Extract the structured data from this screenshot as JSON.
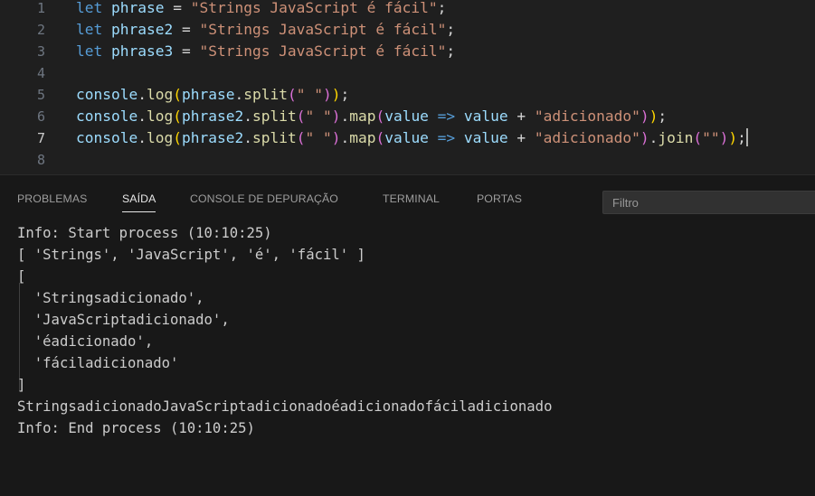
{
  "editor": {
    "lines": [
      {
        "num": "1",
        "tokens": [
          [
            "kw",
            "let "
          ],
          [
            "var",
            "phrase"
          ],
          [
            "op",
            " = "
          ],
          [
            "str",
            "\"Strings JavaScript é fácil\""
          ],
          [
            "punc",
            ";"
          ]
        ]
      },
      {
        "num": "2",
        "tokens": [
          [
            "kw",
            "let "
          ],
          [
            "var",
            "phrase2"
          ],
          [
            "op",
            " = "
          ],
          [
            "str",
            "\"Strings JavaScript é fácil\""
          ],
          [
            "punc",
            ";"
          ]
        ]
      },
      {
        "num": "3",
        "tokens": [
          [
            "kw",
            "let "
          ],
          [
            "var",
            "phrase3"
          ],
          [
            "op",
            " = "
          ],
          [
            "str",
            "\"Strings JavaScript é fácil\""
          ],
          [
            "punc",
            ";"
          ]
        ]
      },
      {
        "num": "4",
        "tokens": []
      },
      {
        "num": "5",
        "tokens": [
          [
            "var",
            "console"
          ],
          [
            "punc",
            "."
          ],
          [
            "fn",
            "log"
          ],
          [
            "p1",
            "("
          ],
          [
            "var",
            "phrase"
          ],
          [
            "punc",
            "."
          ],
          [
            "fn",
            "split"
          ],
          [
            "p2",
            "("
          ],
          [
            "str",
            "\" \""
          ],
          [
            "p2",
            ")"
          ],
          [
            "p1",
            ")"
          ],
          [
            "punc",
            ";"
          ]
        ]
      },
      {
        "num": "6",
        "tokens": [
          [
            "var",
            "console"
          ],
          [
            "punc",
            "."
          ],
          [
            "fn",
            "log"
          ],
          [
            "p1",
            "("
          ],
          [
            "var",
            "phrase2"
          ],
          [
            "punc",
            "."
          ],
          [
            "fn",
            "split"
          ],
          [
            "p2",
            "("
          ],
          [
            "str",
            "\" \""
          ],
          [
            "p2",
            ")"
          ],
          [
            "punc",
            "."
          ],
          [
            "fn",
            "map"
          ],
          [
            "p2",
            "("
          ],
          [
            "var",
            "value"
          ],
          [
            "kw",
            " => "
          ],
          [
            "var",
            "value"
          ],
          [
            "op",
            " + "
          ],
          [
            "str",
            "\"adicionado\""
          ],
          [
            "p2",
            ")"
          ],
          [
            "p1",
            ")"
          ],
          [
            "punc",
            ";"
          ]
        ]
      },
      {
        "num": "7",
        "active": true,
        "tokens": [
          [
            "var",
            "console"
          ],
          [
            "punc",
            "."
          ],
          [
            "fn",
            "log"
          ],
          [
            "p1",
            "("
          ],
          [
            "var",
            "phrase2"
          ],
          [
            "punc",
            "."
          ],
          [
            "fn",
            "split"
          ],
          [
            "p2",
            "("
          ],
          [
            "str",
            "\" \""
          ],
          [
            "p2",
            ")"
          ],
          [
            "punc",
            "."
          ],
          [
            "fn",
            "map"
          ],
          [
            "p2",
            "("
          ],
          [
            "var",
            "value"
          ],
          [
            "kw",
            " => "
          ],
          [
            "var",
            "value"
          ],
          [
            "op",
            " + "
          ],
          [
            "str",
            "\"adicionado\""
          ],
          [
            "p2",
            ")"
          ],
          [
            "punc",
            "."
          ],
          [
            "fn",
            "join"
          ],
          [
            "p2",
            "("
          ],
          [
            "str",
            "\"\""
          ],
          [
            "p2",
            ")"
          ],
          [
            "p1",
            ")"
          ],
          [
            "punc",
            ";"
          ]
        ]
      },
      {
        "num": "8",
        "tokens": []
      }
    ]
  },
  "panel": {
    "tabs": [
      {
        "label": "PROBLEMAS",
        "active": false
      },
      {
        "label": "SAÍDA",
        "active": true
      },
      {
        "label": "CONSOLE DE DEPURAÇÃO",
        "active": false
      },
      {
        "label": "TERMINAL",
        "active": false
      },
      {
        "label": "PORTAS",
        "active": false
      }
    ],
    "filter_placeholder": "Filtro",
    "output": [
      "Info: Start process (10:10:25)",
      "[ 'Strings', 'JavaScript', 'é', 'fácil' ]",
      "[",
      "  'Stringsadicionado',",
      "  'JavaScriptadicionado',",
      "  'éadicionado',",
      "  'fáciladicionado'",
      "]",
      "StringsadicionadoJavaScriptadicionadoéadicionadofáciladicionado",
      "Info: End process (10:10:25)"
    ]
  }
}
